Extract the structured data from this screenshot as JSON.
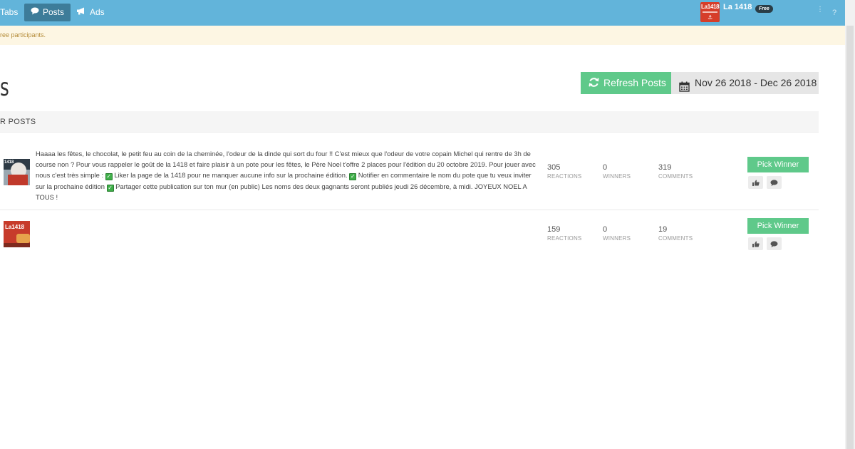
{
  "nav": {
    "tabs_label": "Tabs",
    "posts_label": "Posts",
    "ads_label": "Ads",
    "page_name": "La 1418",
    "page_logo_text": "La1418",
    "plan_badge": "Free"
  },
  "notice": {
    "text": "ree participants."
  },
  "header": {
    "title": "s",
    "refresh_label": "Refresh Posts",
    "date_range": "Nov 26 2018 - Dec 26 2018"
  },
  "section": {
    "title": "R POSTS"
  },
  "posts": [
    {
      "thumb_text": "1418",
      "text_parts": [
        "Haaaa les fêtes, le chocolat, le petit feu au coin de la cheminée, l'odeur de la dinde qui sort du four !! C'est mieux que l'odeur de votre copain Michel qui rentre de 3h de course non ? Pour vous rappeler le goût de la 1418 et faire plaisir à un pote pour les fêtes, le Père Noel t'offre 2 places pour l'édition du 20 octobre 2019. Pour jouer avec nous c'est très simple : ",
        " Liker la page de la 1418 pour ne manquer aucune info sur la prochaine édition. ",
        " Notifier en commentaire le nom du pote que tu veux inviter sur la prochaine édition ",
        " Partager cette publication sur ton mur (en public) Les noms des deux gagnants seront publiés jeudi 26 décembre, à midi. JOYEUX NOEL A TOUS !"
      ],
      "reactions": "305",
      "reactions_label": "REACTIONS",
      "winners": "0",
      "winners_label": "WINNERS",
      "comments": "319",
      "comments_label": "COMMENTS",
      "pick_label": "Pick Winner"
    },
    {
      "thumb_text": "La1418",
      "reactions": "159",
      "reactions_label": "REACTIONS",
      "winners": "0",
      "winners_label": "WINNERS",
      "comments": "19",
      "comments_label": "COMMENTS",
      "pick_label": "Pick Winner"
    }
  ],
  "icons": {
    "checkmark": "✓",
    "dots": "⋮",
    "help": "?"
  },
  "colors": {
    "topbar": "#62b4da",
    "active_tab": "#3d7c99",
    "accent_green": "#5fc98a",
    "notice_bg": "#fdf6e3"
  }
}
